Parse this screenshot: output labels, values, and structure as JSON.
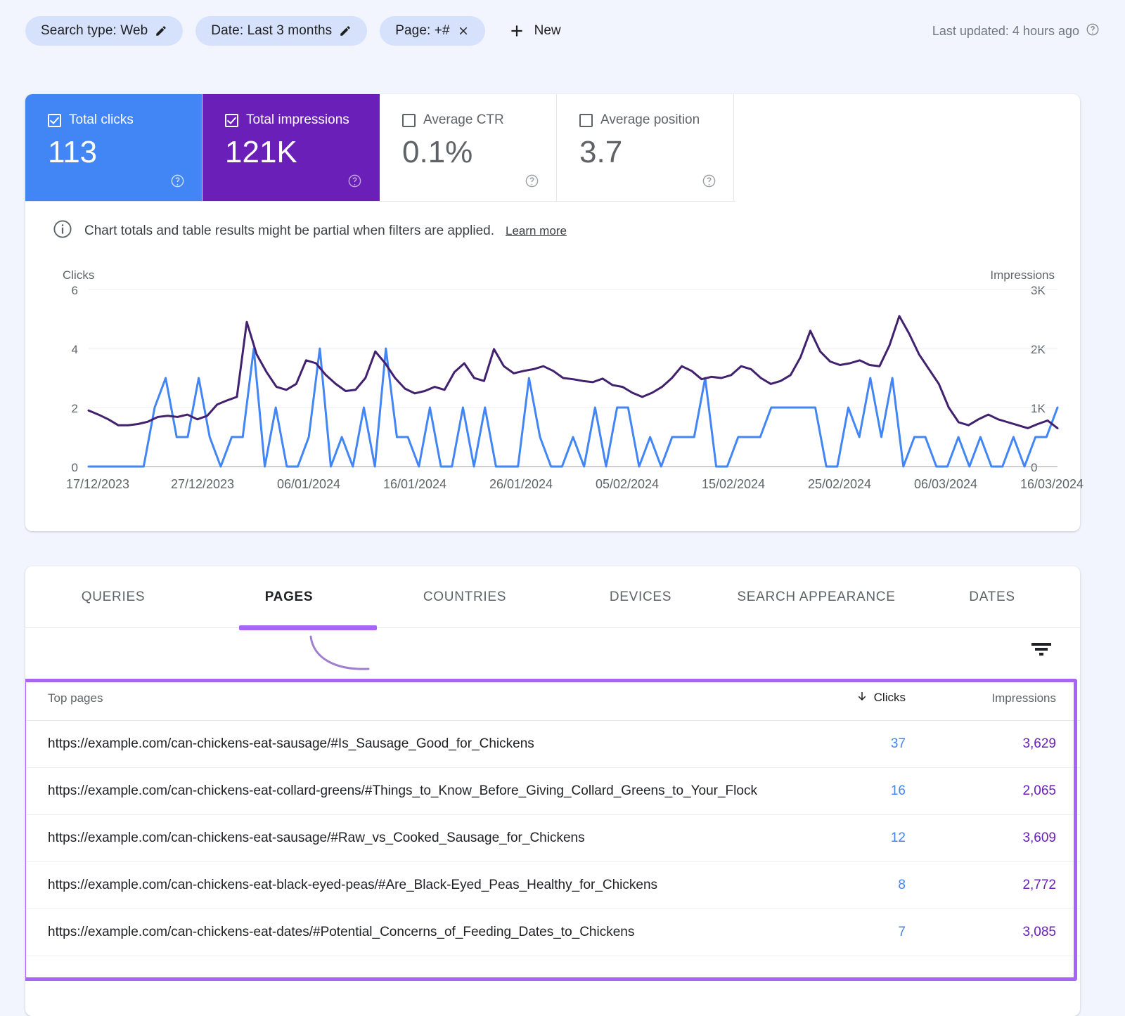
{
  "filter_bar": {
    "chips": [
      {
        "label": "Search type: Web",
        "icon": "pencil-icon",
        "name": "chip-search-type"
      },
      {
        "label": "Date: Last 3 months",
        "icon": "pencil-icon",
        "name": "chip-date"
      },
      {
        "label": "Page: +#",
        "icon": "close-icon",
        "name": "chip-page"
      }
    ],
    "new_button": "New",
    "last_updated": "Last updated: 4 hours ago"
  },
  "metrics": [
    {
      "label": "Total clicks",
      "value": "113",
      "checked": true,
      "color": "#4285f4"
    },
    {
      "label": "Total impressions",
      "value": "121K",
      "checked": true,
      "color": "#6a1fb8"
    },
    {
      "label": "Average CTR",
      "value": "0.1%",
      "checked": false,
      "color": "#ffffff"
    },
    {
      "label": "Average position",
      "value": "3.7",
      "checked": false,
      "color": "#ffffff"
    }
  ],
  "notice": {
    "text": "Chart totals and table results might be partial when filters are applied.",
    "link": "Learn more"
  },
  "chart_data": {
    "type": "line",
    "title": "",
    "left_axis_label": "Clicks",
    "right_axis_label": "Impressions",
    "left_ticks": [
      "0",
      "2",
      "4",
      "6"
    ],
    "right_ticks": [
      "0",
      "1K",
      "2K",
      "3K"
    ],
    "ylim_left": [
      0,
      6
    ],
    "ylim_right": [
      0,
      3000
    ],
    "grid": true,
    "legend": "none",
    "x_tick_labels": [
      "17/12/2023",
      "27/12/2023",
      "06/01/2024",
      "16/01/2024",
      "26/01/2024",
      "05/02/2024",
      "15/02/2024",
      "25/02/2024",
      "06/03/2024",
      "16/03/2024"
    ],
    "x_start": "17/12/2023",
    "x_end": "16/03/2024",
    "series": [
      {
        "name": "Clicks",
        "color": "#4285f4",
        "axis": "left",
        "values": [
          0,
          0,
          0,
          0,
          0,
          0,
          2,
          3,
          1,
          1,
          3,
          1,
          0,
          1,
          1,
          4,
          0,
          2,
          0,
          0,
          1,
          4,
          0,
          1,
          0,
          2,
          0,
          4,
          1,
          1,
          0,
          2,
          0,
          0,
          2,
          0,
          2,
          0,
          0,
          0,
          3,
          1,
          0,
          0,
          1,
          0,
          2,
          0,
          2,
          2,
          0,
          1,
          0,
          1,
          1,
          1,
          3,
          0,
          0,
          1,
          1,
          1,
          2,
          2,
          2,
          2,
          2,
          0,
          0,
          2,
          1,
          3,
          1,
          3,
          0,
          1,
          1,
          0,
          0,
          1,
          0,
          1,
          0,
          0,
          1,
          0,
          1,
          1,
          2
        ]
      },
      {
        "name": "Impressions",
        "color": "#41216e",
        "axis": "right",
        "values": [
          950,
          880,
          800,
          700,
          700,
          720,
          760,
          840,
          860,
          840,
          880,
          800,
          860,
          1050,
          1120,
          1180,
          2450,
          1900,
          1600,
          1350,
          1300,
          1400,
          1800,
          1750,
          1550,
          1400,
          1280,
          1300,
          1500,
          1950,
          1750,
          1500,
          1320,
          1240,
          1280,
          1350,
          1300,
          1600,
          1750,
          1500,
          1450,
          1990,
          1700,
          1580,
          1620,
          1650,
          1700,
          1620,
          1500,
          1480,
          1450,
          1430,
          1490,
          1380,
          1350,
          1250,
          1180,
          1250,
          1350,
          1500,
          1700,
          1620,
          1480,
          1520,
          1500,
          1550,
          1700,
          1650,
          1500,
          1400,
          1450,
          1550,
          1850,
          2300,
          1950,
          1780,
          1720,
          1750,
          1800,
          1720,
          1700,
          2050,
          2550,
          2250,
          1900,
          1650,
          1400,
          1000,
          750,
          700,
          800,
          880,
          800,
          750,
          700,
          650,
          720,
          780,
          650
        ]
      }
    ]
  },
  "tabs": [
    {
      "label": "QUERIES",
      "active": false
    },
    {
      "label": "PAGES",
      "active": true
    },
    {
      "label": "COUNTRIES",
      "active": false
    },
    {
      "label": "DEVICES",
      "active": false
    },
    {
      "label": "SEARCH APPEARANCE",
      "active": false
    },
    {
      "label": "DATES",
      "active": false
    }
  ],
  "table": {
    "columns": {
      "page": "Top pages",
      "clicks": "Clicks",
      "impressions": "Impressions"
    },
    "sorted_by": "clicks",
    "rows": [
      {
        "page": "https://example.com/can-chickens-eat-sausage/#Is_Sausage_Good_for_Chickens",
        "clicks": "37",
        "impressions": "3,629"
      },
      {
        "page": "https://example.com/can-chickens-eat-collard-greens/#Things_to_Know_Before_Giving_Collard_Greens_to_Your_Flock",
        "clicks": "16",
        "impressions": "2,065"
      },
      {
        "page": "https://example.com/can-chickens-eat-sausage/#Raw_vs_Cooked_Sausage_for_Chickens",
        "clicks": "12",
        "impressions": "3,609"
      },
      {
        "page": "https://example.com/can-chickens-eat-black-eyed-peas/#Are_Black-Eyed_Peas_Healthy_for_Chickens",
        "clicks": "8",
        "impressions": "2,772"
      },
      {
        "page": "https://example.com/can-chickens-eat-dates/#Potential_Concerns_of_Feeding_Dates_to_Chickens",
        "clicks": "7",
        "impressions": "3,085"
      }
    ]
  },
  "annotations": {
    "highlight_color": "#a963f5"
  }
}
